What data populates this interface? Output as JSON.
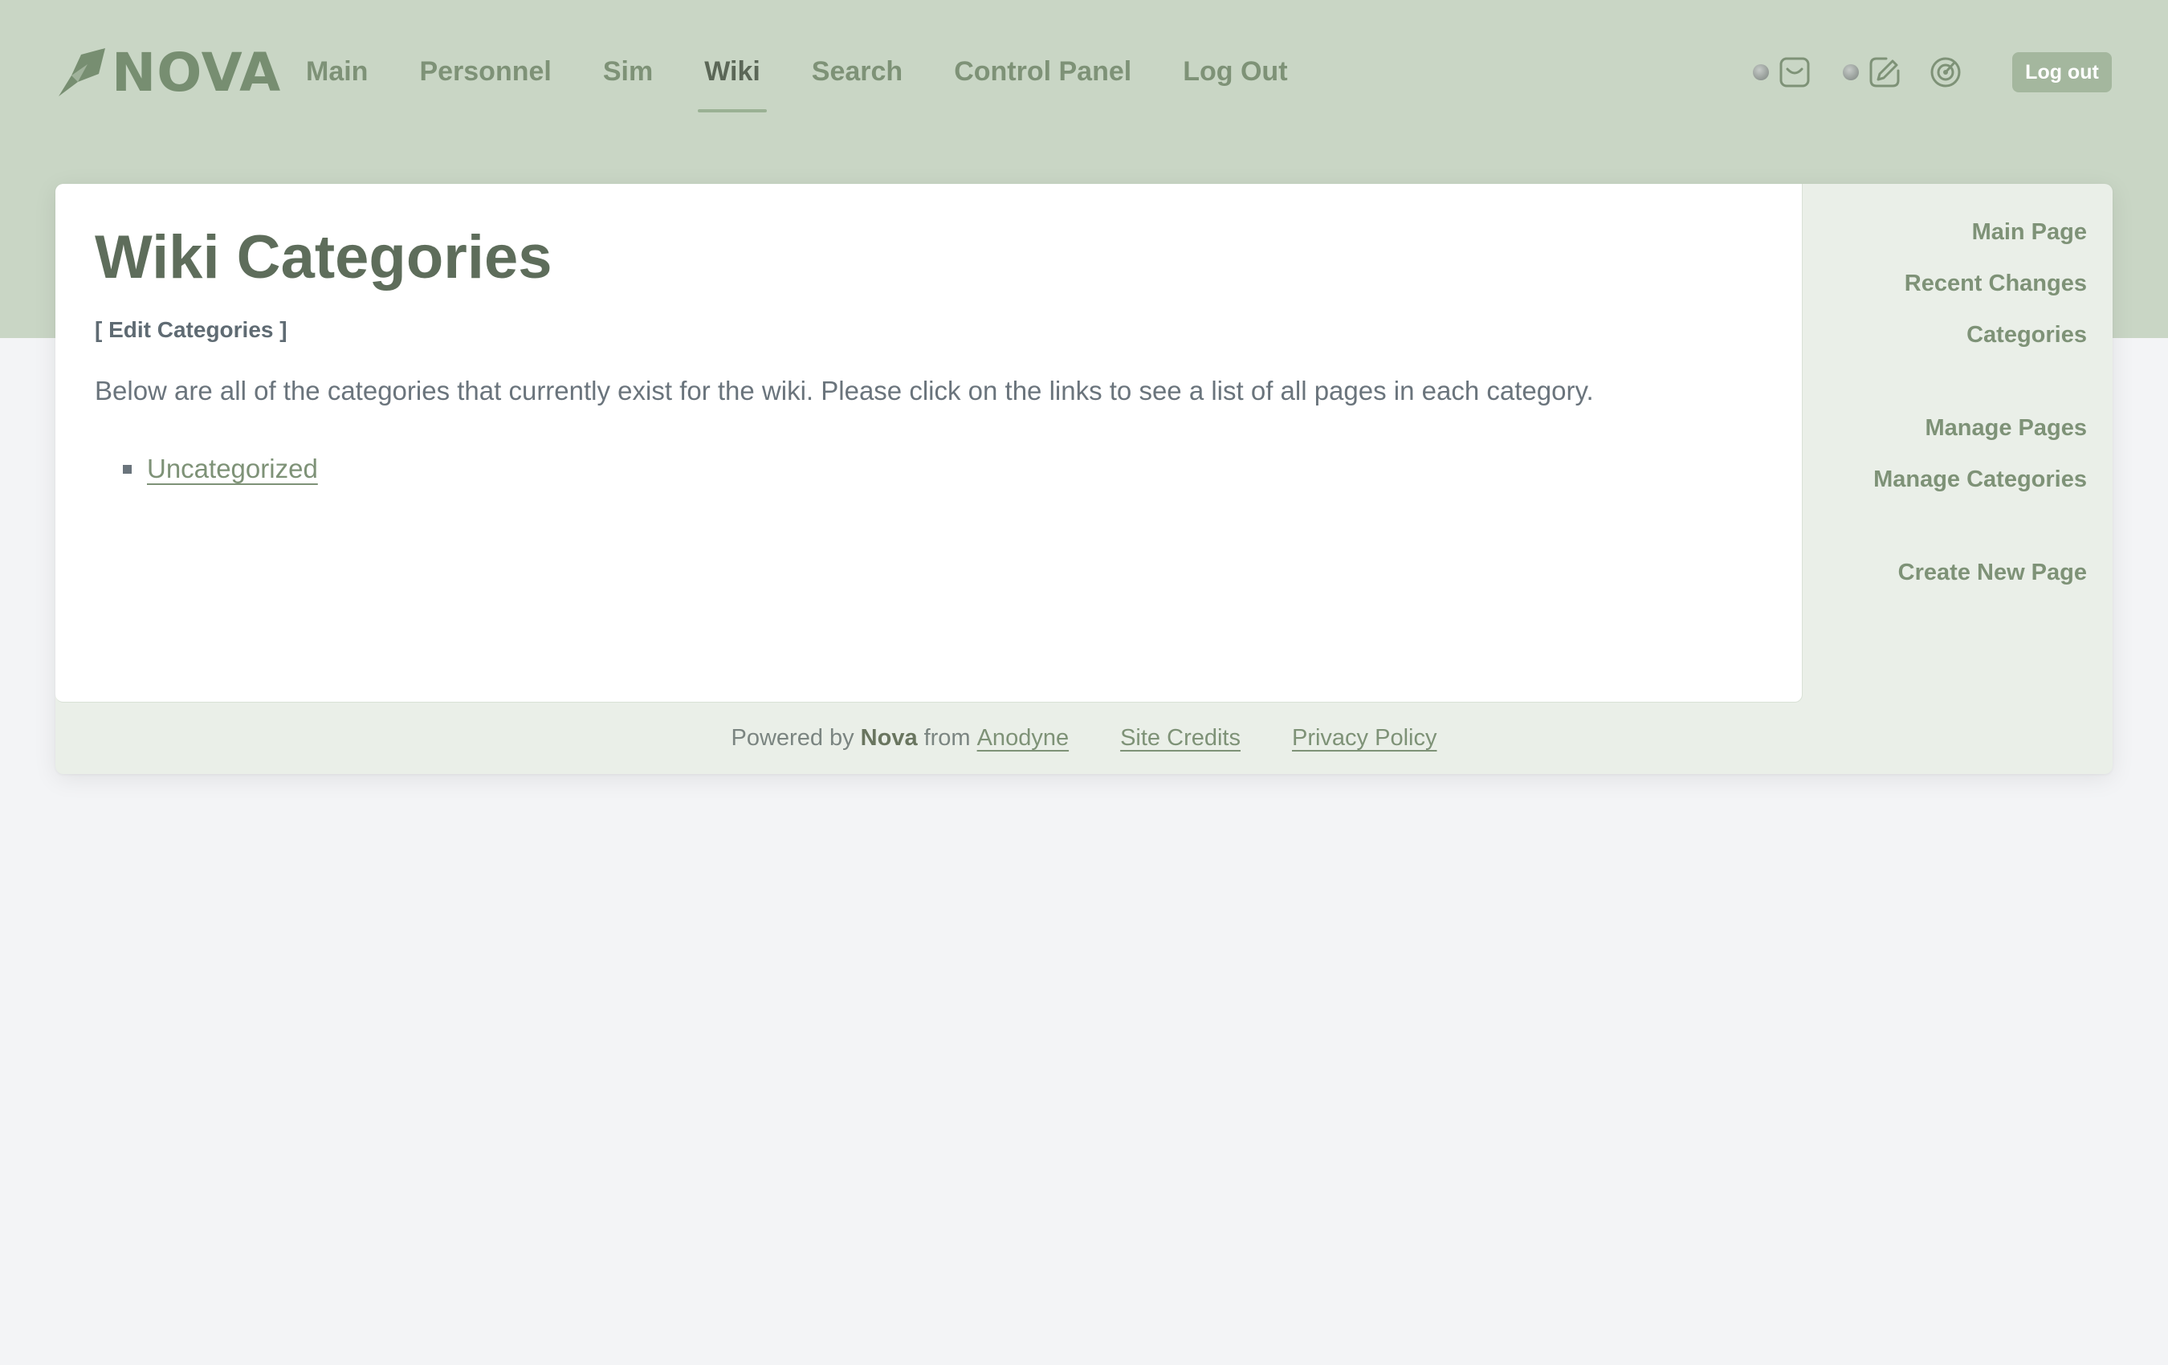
{
  "header": {
    "logo_text": "NOVA",
    "nav": [
      {
        "label": "Main",
        "active": false
      },
      {
        "label": "Personnel",
        "active": false
      },
      {
        "label": "Sim",
        "active": false
      },
      {
        "label": "Wiki",
        "active": true
      },
      {
        "label": "Search",
        "active": false
      },
      {
        "label": "Control Panel",
        "active": false
      },
      {
        "label": "Log Out",
        "active": false
      }
    ],
    "icons": [
      "status-dot",
      "inbox-icon",
      "status-dot",
      "write-icon",
      "radar-icon"
    ],
    "logout_button": "Log out"
  },
  "main": {
    "title": "Wiki Categories",
    "edit_link": "[ Edit Categories ]",
    "intro": "Below are all of the categories that currently exist for the wiki. Please click on the links to see a list of all pages in each category.",
    "categories": [
      "Uncategorized"
    ]
  },
  "sidebar": {
    "links": [
      "Main Page",
      "Recent Changes",
      "Categories",
      "Manage Pages",
      "Manage Categories",
      "Create New Page"
    ]
  },
  "footer": {
    "powered_by": "Powered by",
    "brand": "Nova",
    "from": "from",
    "anodyne": "Anodyne",
    "site_credits": "Site Credits",
    "privacy_policy": "Privacy Policy"
  },
  "colors": {
    "header_bg": "#c9d6c5",
    "accent": "#7e9277",
    "button_bg": "#a4b79e",
    "page_bg": "#f3f4f6"
  }
}
